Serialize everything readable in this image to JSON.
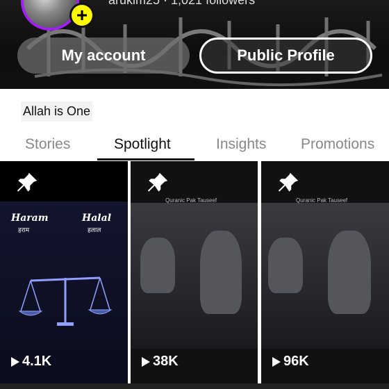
{
  "profile": {
    "username_line": "arukim25 · 1,021 followers",
    "bio": "Allah is One"
  },
  "buttons": {
    "my_account": "My account",
    "public_profile": "Public Profile"
  },
  "tabs": [
    {
      "label": "Stories",
      "active": false
    },
    {
      "label": "Spotlight",
      "active": true
    },
    {
      "label": "Insights",
      "active": false
    },
    {
      "label": "Promotions",
      "active": false
    }
  ],
  "tiles": [
    {
      "views": "4.1K",
      "icon": "pin-icon",
      "haram": "Haram",
      "haram_sub": "हराम",
      "halal": "Halal",
      "halal_sub": "हलाल"
    },
    {
      "views": "38K",
      "icon": "pin-icon",
      "caption": "Quranic Pak Tauseef"
    },
    {
      "views": "96K",
      "icon": "pin-icon",
      "caption": "Quranic Pak Tauseef"
    }
  ],
  "colors": {
    "avatar_ring": "#a020f0",
    "plus_badge": "#fffc00"
  }
}
